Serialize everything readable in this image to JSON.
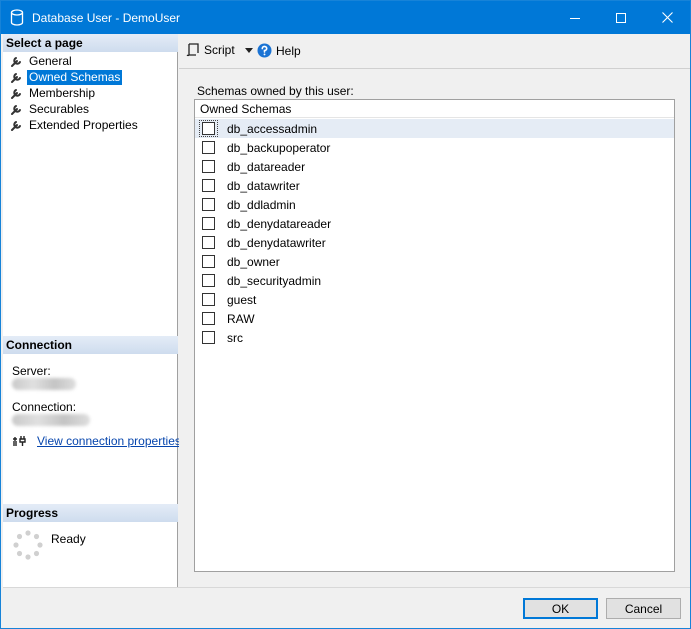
{
  "window": {
    "title": "Database User - DemoUser"
  },
  "left_pane": {
    "select_page_header": "Select a page",
    "pages": [
      {
        "label": "General",
        "selected": false
      },
      {
        "label": "Owned Schemas",
        "selected": true
      },
      {
        "label": "Membership",
        "selected": false
      },
      {
        "label": "Securables",
        "selected": false
      },
      {
        "label": "Extended Properties",
        "selected": false
      }
    ],
    "connection_header": "Connection",
    "server_label": "Server:",
    "connection_label": "Connection:",
    "view_connection_properties": "View connection properties",
    "progress_header": "Progress",
    "progress_status": "Ready"
  },
  "toolbar": {
    "script_label": "Script",
    "help_label": "Help"
  },
  "main": {
    "schemas_label": "Schemas owned by this user:",
    "column_header": "Owned Schemas",
    "schemas": [
      {
        "name": "db_accessadmin",
        "checked": false
      },
      {
        "name": "db_backupoperator",
        "checked": false
      },
      {
        "name": "db_datareader",
        "checked": false
      },
      {
        "name": "db_datawriter",
        "checked": false
      },
      {
        "name": "db_ddladmin",
        "checked": false
      },
      {
        "name": "db_denydatareader",
        "checked": false
      },
      {
        "name": "db_denydatawriter",
        "checked": false
      },
      {
        "name": "db_owner",
        "checked": false
      },
      {
        "name": "db_securityadmin",
        "checked": false
      },
      {
        "name": "guest",
        "checked": false
      },
      {
        "name": "RAW",
        "checked": false
      },
      {
        "name": "src",
        "checked": false
      }
    ]
  },
  "footer": {
    "ok_label": "OK",
    "cancel_label": "Cancel"
  },
  "colors": {
    "accent": "#0078d7",
    "link": "#0645ad",
    "section_header": "#d6e2f1"
  }
}
